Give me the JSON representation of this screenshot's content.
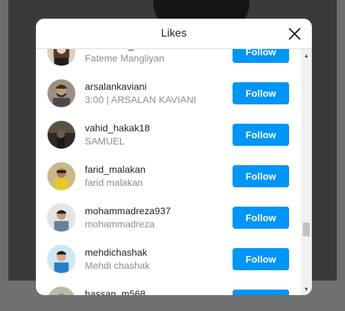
{
  "modal": {
    "title": "Likes",
    "close_icon": "close-icon"
  },
  "list": {
    "follow_label": "Follow",
    "items": [
      {
        "username": "skinhouse_helen",
        "fullname": "Fateme Mangliyan"
      },
      {
        "username": "arsalankaviani",
        "fullname": "3:00 | ARSALAN KAVIANI"
      },
      {
        "username": "vahid_hakak18",
        "fullname": "SAMUEL"
      },
      {
        "username": "farid_malakan",
        "fullname": "farid malakan"
      },
      {
        "username": "mohammadreza937",
        "fullname": "mohammadreza"
      },
      {
        "username": "mehdichashak",
        "fullname": "Mehdi chashak"
      },
      {
        "username": "hassan_m568",
        "fullname": ""
      }
    ]
  },
  "colors": {
    "accent": "#0095f6",
    "primary_text": "#262626",
    "secondary_text": "#8e8e8e"
  }
}
